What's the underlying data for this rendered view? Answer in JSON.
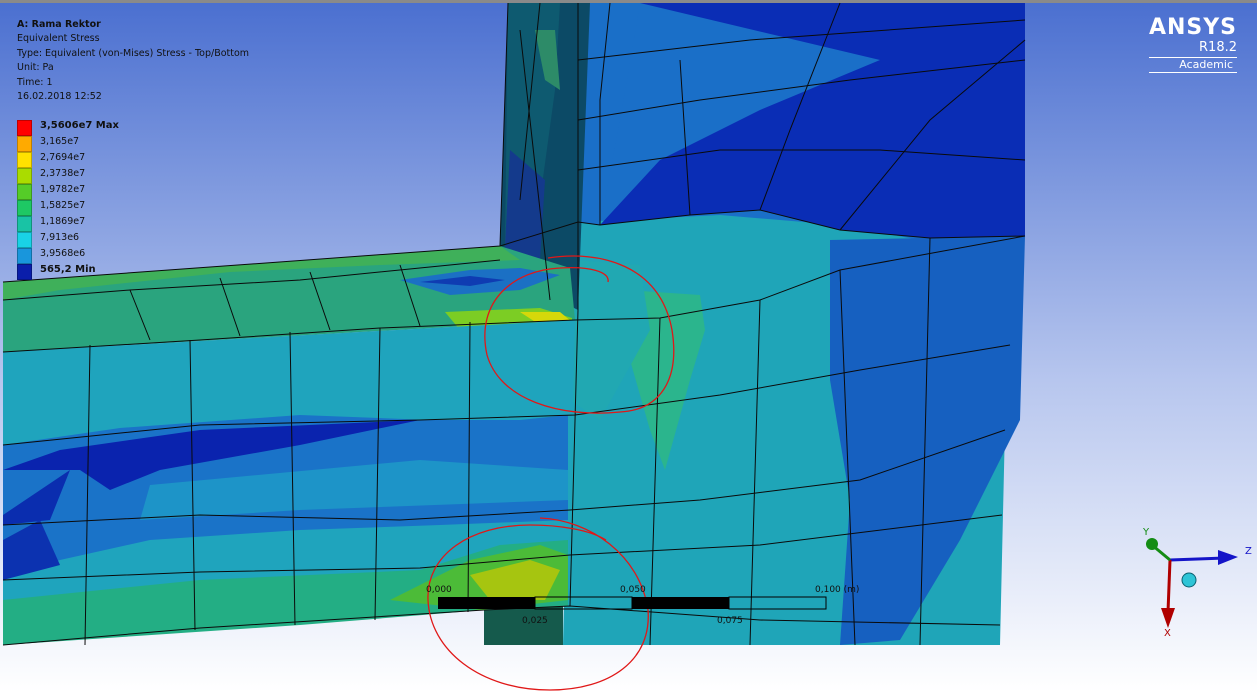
{
  "result": {
    "system": "A: Rama Rektor",
    "name": "Equivalent Stress",
    "type": "Type: Equivalent (von-Mises) Stress - Top/Bottom",
    "unit": "Unit: Pa",
    "time": "Time: 1",
    "date": "16.02.2018 12:52"
  },
  "legend": [
    {
      "label": "3,5606e7 Max",
      "color": "#ff0000",
      "bold": true
    },
    {
      "label": "3,165e7",
      "color": "#ffaa00",
      "bold": false
    },
    {
      "label": "2,7694e7",
      "color": "#ffe100",
      "bold": false
    },
    {
      "label": "2,3738e7",
      "color": "#aadc00",
      "bold": false
    },
    {
      "label": "1,9782e7",
      "color": "#55cc28",
      "bold": false
    },
    {
      "label": "1,5825e7",
      "color": "#1ec864",
      "bold": false
    },
    {
      "label": "1,1869e7",
      "color": "#19c3a5",
      "bold": false
    },
    {
      "label": "7,913e6",
      "color": "#19d2e6",
      "bold": false
    },
    {
      "label": "3,9568e6",
      "color": "#1996dc",
      "bold": false
    },
    {
      "label": "565,2 Min",
      "color": "#0a1eaa",
      "bold": true
    }
  ],
  "brand": {
    "name": "ANSYS",
    "version": "R18.2",
    "license": "Academic"
  },
  "scale_bar": {
    "top_labels": [
      "0,000",
      "0,050",
      "0,100 (m)"
    ],
    "bottom_labels": [
      "0,025",
      "0,075"
    ]
  },
  "triad": {
    "y": "Y",
    "z": "Z",
    "x": "X"
  },
  "colors": {
    "background_top": "#4a6fd0",
    "background_bottom": "#ffffff",
    "annotation": "#e01818",
    "mesh": "#0a0a0a"
  }
}
